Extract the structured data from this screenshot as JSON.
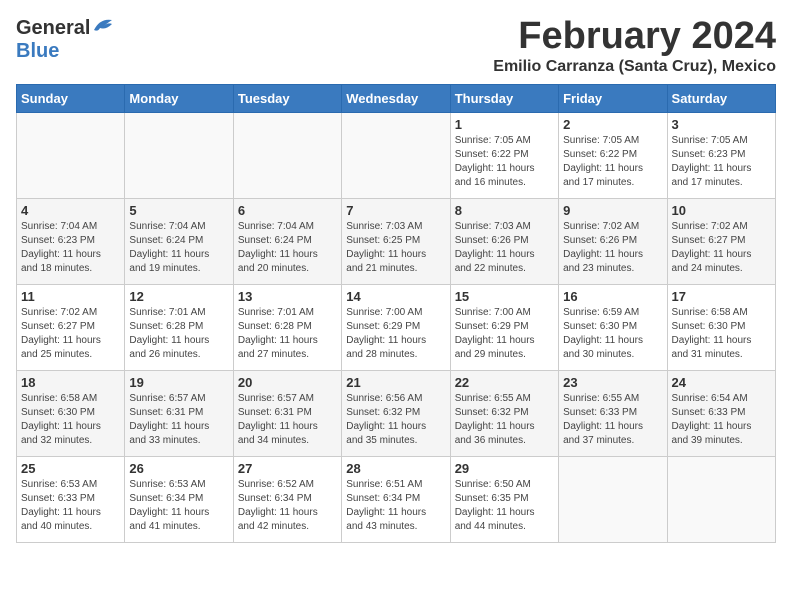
{
  "logo": {
    "general": "General",
    "blue": "Blue"
  },
  "title": "February 2024",
  "subtitle": "Emilio Carranza (Santa Cruz), Mexico",
  "days_of_week": [
    "Sunday",
    "Monday",
    "Tuesday",
    "Wednesday",
    "Thursday",
    "Friday",
    "Saturday"
  ],
  "weeks": [
    [
      {
        "day": "",
        "info": ""
      },
      {
        "day": "",
        "info": ""
      },
      {
        "day": "",
        "info": ""
      },
      {
        "day": "",
        "info": ""
      },
      {
        "day": "1",
        "info": "Sunrise: 7:05 AM\nSunset: 6:22 PM\nDaylight: 11 hours\nand 16 minutes."
      },
      {
        "day": "2",
        "info": "Sunrise: 7:05 AM\nSunset: 6:22 PM\nDaylight: 11 hours\nand 17 minutes."
      },
      {
        "day": "3",
        "info": "Sunrise: 7:05 AM\nSunset: 6:23 PM\nDaylight: 11 hours\nand 17 minutes."
      }
    ],
    [
      {
        "day": "4",
        "info": "Sunrise: 7:04 AM\nSunset: 6:23 PM\nDaylight: 11 hours\nand 18 minutes."
      },
      {
        "day": "5",
        "info": "Sunrise: 7:04 AM\nSunset: 6:24 PM\nDaylight: 11 hours\nand 19 minutes."
      },
      {
        "day": "6",
        "info": "Sunrise: 7:04 AM\nSunset: 6:24 PM\nDaylight: 11 hours\nand 20 minutes."
      },
      {
        "day": "7",
        "info": "Sunrise: 7:03 AM\nSunset: 6:25 PM\nDaylight: 11 hours\nand 21 minutes."
      },
      {
        "day": "8",
        "info": "Sunrise: 7:03 AM\nSunset: 6:26 PM\nDaylight: 11 hours\nand 22 minutes."
      },
      {
        "day": "9",
        "info": "Sunrise: 7:02 AM\nSunset: 6:26 PM\nDaylight: 11 hours\nand 23 minutes."
      },
      {
        "day": "10",
        "info": "Sunrise: 7:02 AM\nSunset: 6:27 PM\nDaylight: 11 hours\nand 24 minutes."
      }
    ],
    [
      {
        "day": "11",
        "info": "Sunrise: 7:02 AM\nSunset: 6:27 PM\nDaylight: 11 hours\nand 25 minutes."
      },
      {
        "day": "12",
        "info": "Sunrise: 7:01 AM\nSunset: 6:28 PM\nDaylight: 11 hours\nand 26 minutes."
      },
      {
        "day": "13",
        "info": "Sunrise: 7:01 AM\nSunset: 6:28 PM\nDaylight: 11 hours\nand 27 minutes."
      },
      {
        "day": "14",
        "info": "Sunrise: 7:00 AM\nSunset: 6:29 PM\nDaylight: 11 hours\nand 28 minutes."
      },
      {
        "day": "15",
        "info": "Sunrise: 7:00 AM\nSunset: 6:29 PM\nDaylight: 11 hours\nand 29 minutes."
      },
      {
        "day": "16",
        "info": "Sunrise: 6:59 AM\nSunset: 6:30 PM\nDaylight: 11 hours\nand 30 minutes."
      },
      {
        "day": "17",
        "info": "Sunrise: 6:58 AM\nSunset: 6:30 PM\nDaylight: 11 hours\nand 31 minutes."
      }
    ],
    [
      {
        "day": "18",
        "info": "Sunrise: 6:58 AM\nSunset: 6:30 PM\nDaylight: 11 hours\nand 32 minutes."
      },
      {
        "day": "19",
        "info": "Sunrise: 6:57 AM\nSunset: 6:31 PM\nDaylight: 11 hours\nand 33 minutes."
      },
      {
        "day": "20",
        "info": "Sunrise: 6:57 AM\nSunset: 6:31 PM\nDaylight: 11 hours\nand 34 minutes."
      },
      {
        "day": "21",
        "info": "Sunrise: 6:56 AM\nSunset: 6:32 PM\nDaylight: 11 hours\nand 35 minutes."
      },
      {
        "day": "22",
        "info": "Sunrise: 6:55 AM\nSunset: 6:32 PM\nDaylight: 11 hours\nand 36 minutes."
      },
      {
        "day": "23",
        "info": "Sunrise: 6:55 AM\nSunset: 6:33 PM\nDaylight: 11 hours\nand 37 minutes."
      },
      {
        "day": "24",
        "info": "Sunrise: 6:54 AM\nSunset: 6:33 PM\nDaylight: 11 hours\nand 39 minutes."
      }
    ],
    [
      {
        "day": "25",
        "info": "Sunrise: 6:53 AM\nSunset: 6:33 PM\nDaylight: 11 hours\nand 40 minutes."
      },
      {
        "day": "26",
        "info": "Sunrise: 6:53 AM\nSunset: 6:34 PM\nDaylight: 11 hours\nand 41 minutes."
      },
      {
        "day": "27",
        "info": "Sunrise: 6:52 AM\nSunset: 6:34 PM\nDaylight: 11 hours\nand 42 minutes."
      },
      {
        "day": "28",
        "info": "Sunrise: 6:51 AM\nSunset: 6:34 PM\nDaylight: 11 hours\nand 43 minutes."
      },
      {
        "day": "29",
        "info": "Sunrise: 6:50 AM\nSunset: 6:35 PM\nDaylight: 11 hours\nand 44 minutes."
      },
      {
        "day": "",
        "info": ""
      },
      {
        "day": "",
        "info": ""
      }
    ]
  ]
}
